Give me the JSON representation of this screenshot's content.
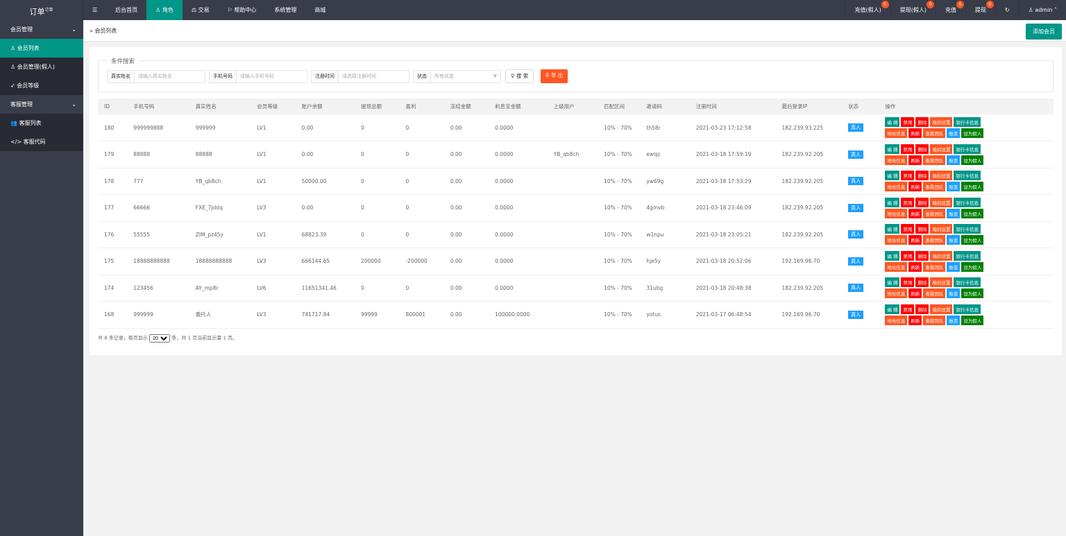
{
  "logo": {
    "title": "订单",
    "sup": "订单"
  },
  "topnav": {
    "menu_icon": "☰",
    "items": [
      "后台首页",
      "角色",
      "交易",
      "帮助中心",
      "系统管理",
      "商城"
    ],
    "active": 1
  },
  "topright": [
    {
      "label": "充值(假人)",
      "badge": "0"
    },
    {
      "label": "提现(假人)",
      "badge": "0"
    },
    {
      "label": "充值",
      "badge": "0"
    },
    {
      "label": "提现",
      "badge": "0"
    }
  ],
  "user": "admin",
  "sidebar": {
    "groups": [
      {
        "label": "会员管理",
        "items": [
          "会员列表",
          "会员管理(假人)",
          "会员等级"
        ]
      },
      {
        "label": "客服管理",
        "items": [
          "客服列表",
          "客服代码"
        ]
      }
    ]
  },
  "breadcrumb": "会员列表",
  "add_button": "添加会员",
  "search": {
    "legend": "条件搜索",
    "name_label": "真实姓名",
    "name_placeholder": "请输入真实姓名",
    "phone_label": "手机号码",
    "phone_placeholder": "请输入手机号码",
    "time_label": "注册时间",
    "time_placeholder": "请选择注册时间",
    "status_label": "状态",
    "status_value": "所有状态",
    "search_btn": "搜 索",
    "export_btn": "导 出"
  },
  "table": {
    "headers": [
      "ID",
      "手机号码",
      "真实姓名",
      "会员等级",
      "账户余额",
      "提现总额",
      "盈利",
      "冻结金额",
      "利息宝金额",
      "上级用户",
      "匹配区间",
      "邀请码",
      "注册时间",
      "最后登录IP",
      "状态",
      "操作"
    ],
    "rows": [
      [
        "180",
        "999999888",
        "999999",
        "LV1",
        "0.00",
        "0",
        "0",
        "0.00",
        "0.0000",
        "",
        "10% - 70%",
        "th58r",
        "2021-03-23 17:12:58",
        "182.239.93.225",
        "真人"
      ],
      [
        "179",
        "88888",
        "88888",
        "LV1",
        "0.00",
        "0",
        "0",
        "0.00",
        "0.0000",
        "YB_qb8ch",
        "10% - 70%",
        "ewlpj",
        "2021-03-18 17:59:19",
        "182.239.92.205",
        "真人"
      ],
      [
        "178",
        "777",
        "YB_qb8ch",
        "LV1",
        "50000.00",
        "0",
        "0",
        "0.00",
        "0.0000",
        "",
        "10% - 70%",
        "yw69g",
        "2021-03-18 17:53:29",
        "182.239.92.205",
        "真人"
      ],
      [
        "177",
        "66666",
        "FXE_7jddq",
        "LV3",
        "0.00",
        "0",
        "0",
        "0.00",
        "0.0000",
        "",
        "10% - 70%",
        "4gmvb",
        "2021-03-18 23:46:09",
        "182.239.92.205",
        "真人"
      ],
      [
        "176",
        "55555",
        "ZIM_pz45y",
        "LV1",
        "68823.39",
        "0",
        "0",
        "0.00",
        "0.0000",
        "",
        "10% - 70%",
        "w1npu",
        "2021-03-18 23:05:21",
        "182.239.92.205",
        "真人"
      ],
      [
        "175",
        "18888888888",
        "18888888888",
        "LV3",
        "666144.65",
        "200000",
        "-200000",
        "0.00",
        "0.0000",
        "",
        "10% - 70%",
        "hje5y",
        "2021-03-18 20:52:06",
        "192.169.96.70",
        "真人"
      ],
      [
        "174",
        "123456",
        "AY_mp8r",
        "LV6",
        "11651341.46",
        "0",
        "0",
        "0.00",
        "0.0000",
        "",
        "10% - 70%",
        "31ubg",
        "2021-03-18 20:48:38",
        "182.239.92.205",
        "真人"
      ],
      [
        "168",
        "999999",
        "委托人",
        "LV3",
        "741717.84",
        "99999",
        "800001",
        "0.00",
        "100000.0000",
        "",
        "10% - 70%",
        "yotus",
        "2021-03-17 06:48:54",
        "192.169.96.70",
        "真人"
      ]
    ],
    "actions": [
      {
        "label": "编 辑",
        "color": "#009688"
      },
      {
        "label": "禁用",
        "color": "#FF0000"
      },
      {
        "label": "删除",
        "color": "#FF0000"
      },
      {
        "label": "暗扣设置",
        "color": "#FF5722"
      },
      {
        "label": "银行卡信息",
        "color": "#009688"
      },
      {
        "label": "地址信息",
        "color": "#FF5722"
      },
      {
        "label": "刷新",
        "color": "#FF0000"
      },
      {
        "label": "查看团队",
        "color": "#FF5722"
      },
      {
        "label": "账变",
        "color": "#1E9FFF"
      },
      {
        "label": "设为假人",
        "color": "#008000"
      }
    ]
  },
  "pager": {
    "pre": "共 8 条记录，每页显示",
    "size": "20",
    "post": "条，共 1 页当前显示第 1 页。"
  }
}
